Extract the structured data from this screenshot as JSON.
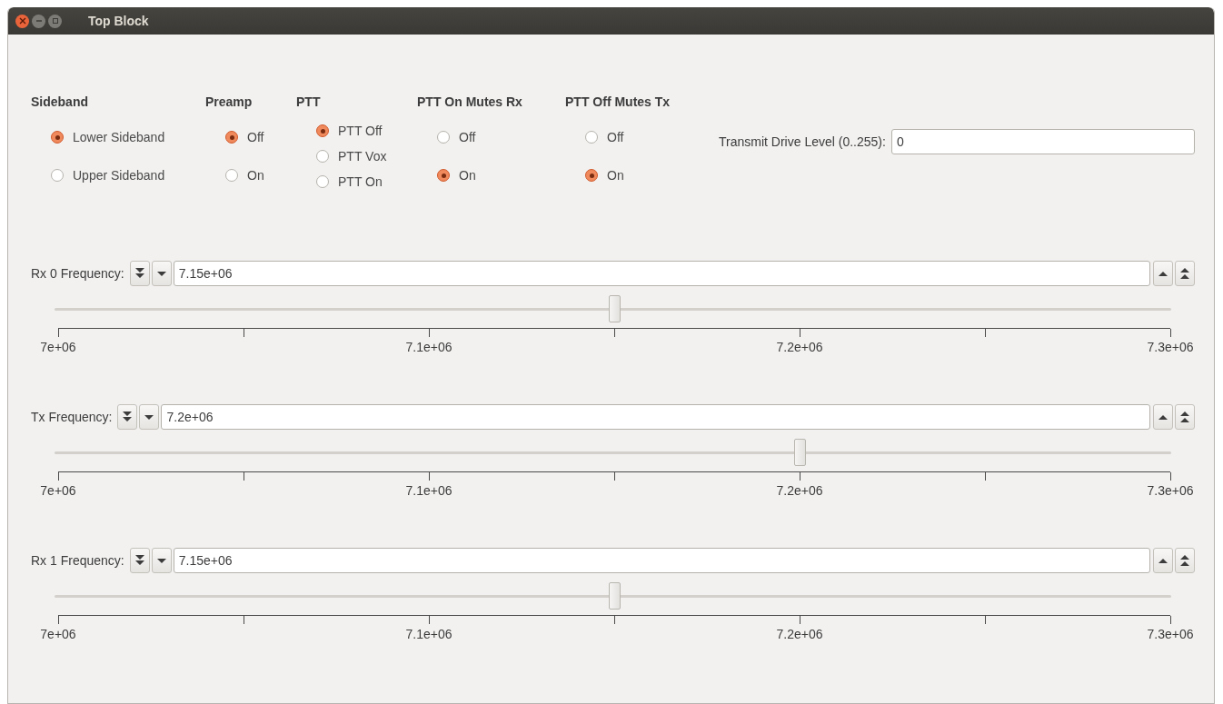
{
  "window": {
    "title": "Top Block"
  },
  "radio_groups": [
    {
      "label": "Sideband",
      "options": [
        {
          "label": "Lower Sideband",
          "selected": true
        },
        {
          "label": "Upper Sideband",
          "selected": false
        }
      ]
    },
    {
      "label": "Preamp",
      "options": [
        {
          "label": "Off",
          "selected": true
        },
        {
          "label": "On",
          "selected": false
        }
      ]
    },
    {
      "label": "PTT",
      "options": [
        {
          "label": "PTT Off",
          "selected": true
        },
        {
          "label": "PTT Vox",
          "selected": false
        },
        {
          "label": "PTT On",
          "selected": false
        }
      ]
    },
    {
      "label": "PTT On Mutes Rx",
      "options": [
        {
          "label": "Off",
          "selected": false
        },
        {
          "label": "On",
          "selected": true
        }
      ]
    },
    {
      "label": "PTT Off Mutes Tx",
      "options": [
        {
          "label": "Off",
          "selected": false
        },
        {
          "label": "On",
          "selected": true
        }
      ]
    }
  ],
  "drive_level": {
    "label": "Transmit Drive Level (0..255):",
    "value": "0"
  },
  "frequencies": [
    {
      "label": "Rx 0 Frequency:",
      "value": "7.15e+06",
      "level": 0.5,
      "ticks": [
        "7e+06",
        "7.1e+06",
        "7.2e+06",
        "7.3e+06"
      ]
    },
    {
      "label": "Tx Frequency:",
      "value": "7.2e+06",
      "level": 0.6667,
      "ticks": [
        "7e+06",
        "7.1e+06",
        "7.2e+06",
        "7.3e+06"
      ]
    },
    {
      "label": "Rx 1 Frequency:",
      "value": "7.15e+06",
      "level": 0.5,
      "ticks": [
        "7e+06",
        "7.1e+06",
        "7.2e+06",
        "7.3e+06"
      ]
    }
  ]
}
